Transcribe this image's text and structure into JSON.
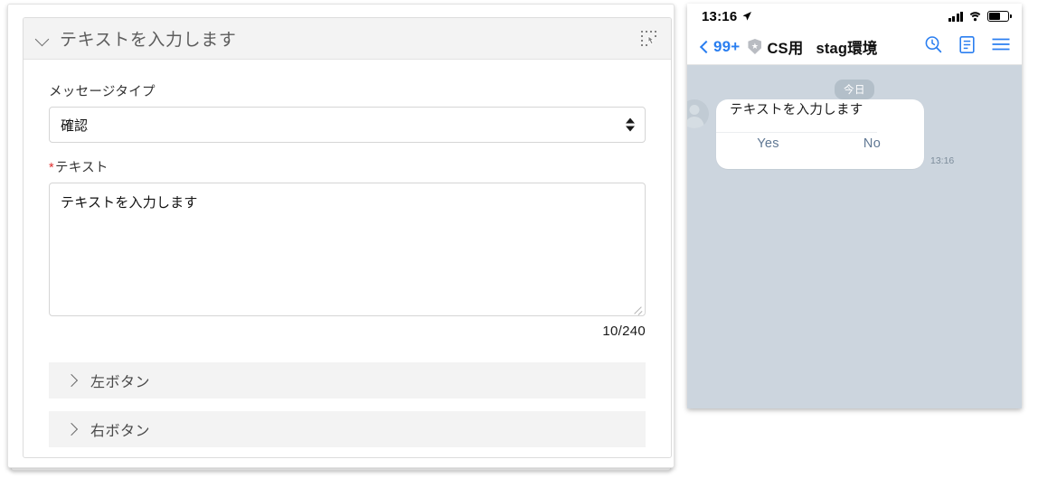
{
  "editor": {
    "header": {
      "title": "テキストを入力します",
      "collapse_icon": "chevron-down-icon",
      "drag_icon": "drag-select-hand-icon"
    },
    "message_type": {
      "label": "メッセージタイプ",
      "value": "確認"
    },
    "text_field": {
      "label": "テキスト",
      "required_mark": "*",
      "value": "テキストを入力します",
      "counter": "10/240"
    },
    "accordions": [
      {
        "label": "左ボタン",
        "icon": "chevron-right-icon"
      },
      {
        "label": "右ボタン",
        "icon": "chevron-right-icon"
      }
    ]
  },
  "phone": {
    "status_bar": {
      "time": "13:16",
      "location_icon": "location-arrow-icon",
      "signal_icon": "signal-bars-icon",
      "wifi_icon": "wifi-icon",
      "battery_icon": "battery-icon"
    },
    "nav_bar": {
      "back_label": "99+",
      "back_icon": "chevron-left-icon",
      "shield_icon": "shield-star-icon",
      "title": "CS用",
      "subtitle": "stag環境",
      "actions": [
        {
          "icon": "search-clock-icon"
        },
        {
          "icon": "note-document-icon"
        },
        {
          "icon": "hamburger-menu-icon"
        }
      ]
    },
    "chat": {
      "date_label": "今日",
      "avatar_icon": "user-avatar-icon",
      "message": {
        "text": "テキストを入力します",
        "buttons": [
          "Yes",
          "No"
        ],
        "time": "13:16"
      }
    }
  },
  "colors": {
    "accent_blue": "#2a7ef0",
    "required_red": "#e03030",
    "chat_bg": "#ccd5de",
    "button_text": "#5f7793"
  }
}
